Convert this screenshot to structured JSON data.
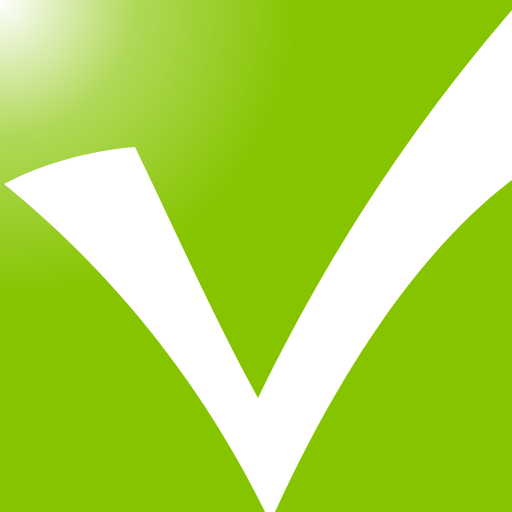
{
  "icon": {
    "name": "checkmark-icon",
    "colors": {
      "background": "#86c400",
      "background_highlight": "#ffffff",
      "mark": "#ffffff"
    }
  }
}
